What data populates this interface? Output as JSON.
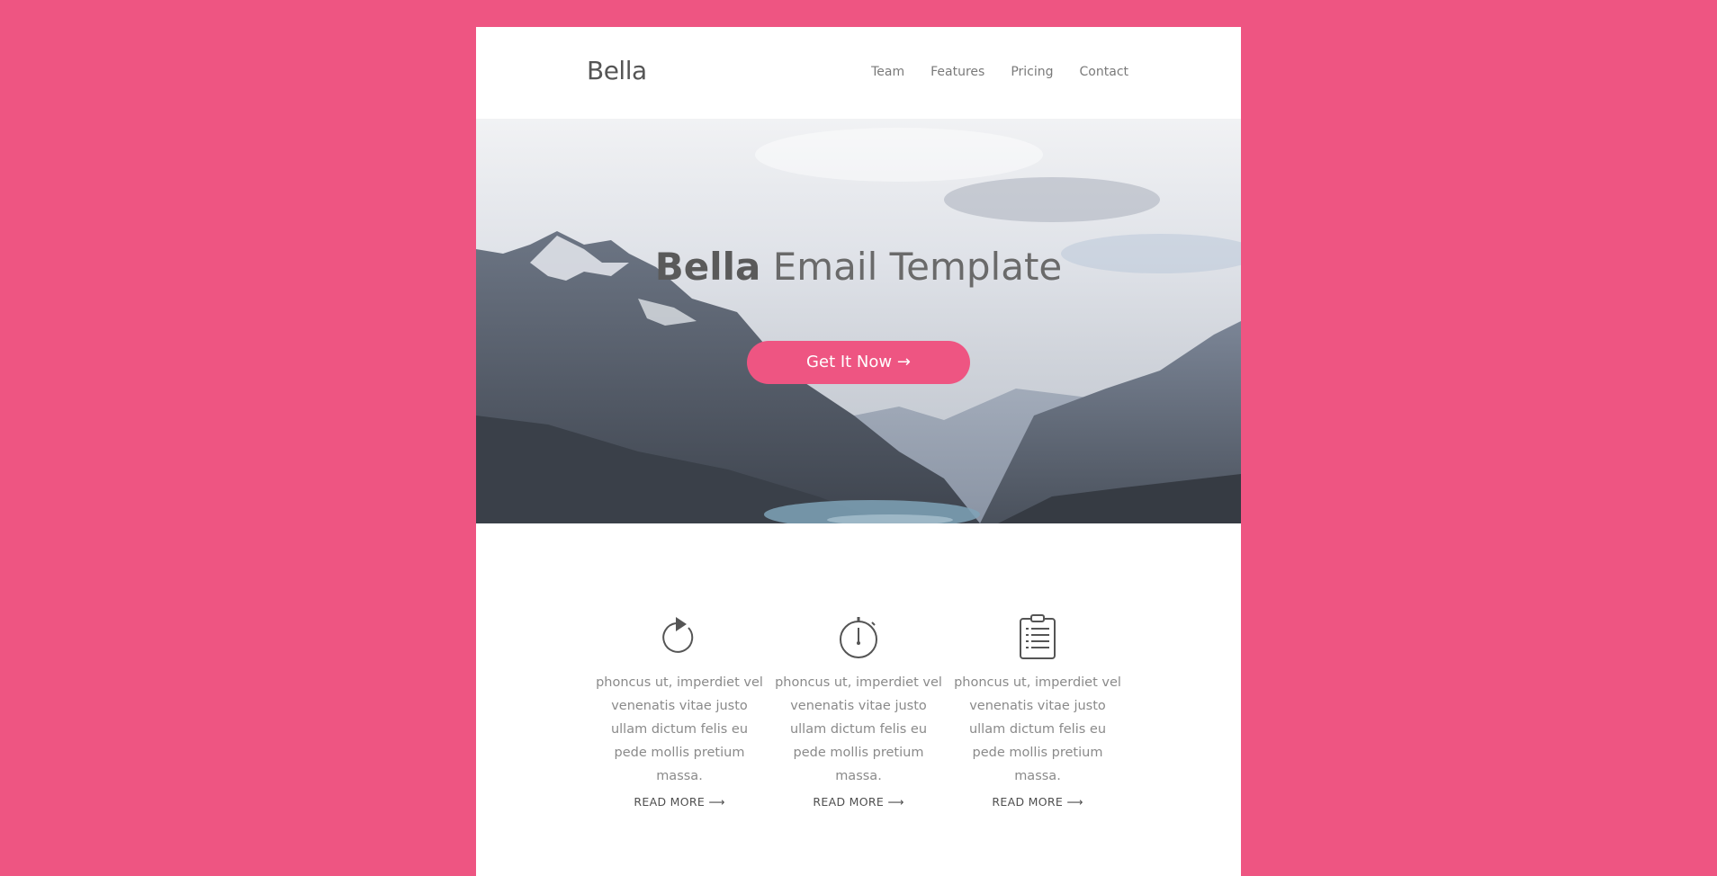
{
  "brand": {
    "name": "Bella",
    "accent": "#ee5582"
  },
  "nav": {
    "items": [
      {
        "label": "Team"
      },
      {
        "label": "Features"
      },
      {
        "label": "Pricing"
      },
      {
        "label": "Contact"
      }
    ]
  },
  "hero": {
    "title_bold": "Bella",
    "title_light": "Email Template",
    "cta_label": "Get It Now →"
  },
  "features": [
    {
      "icon": "refresh-icon",
      "text": "phoncus ut, imperdiet vel venenatis vitae justo ullam dictum felis eu pede mollis pretium massa.",
      "link": "READ MORE ⟶"
    },
    {
      "icon": "stopwatch-icon",
      "text": "phoncus ut, imperdiet vel venenatis vitae justo ullam dictum felis eu pede mollis pretium massa.",
      "link": "READ MORE ⟶"
    },
    {
      "icon": "clipboard-icon",
      "text": "phoncus ut, imperdiet vel venenatis vitae justo ullam dictum felis eu pede mollis pretium massa.",
      "link": "READ MORE ⟶"
    }
  ]
}
